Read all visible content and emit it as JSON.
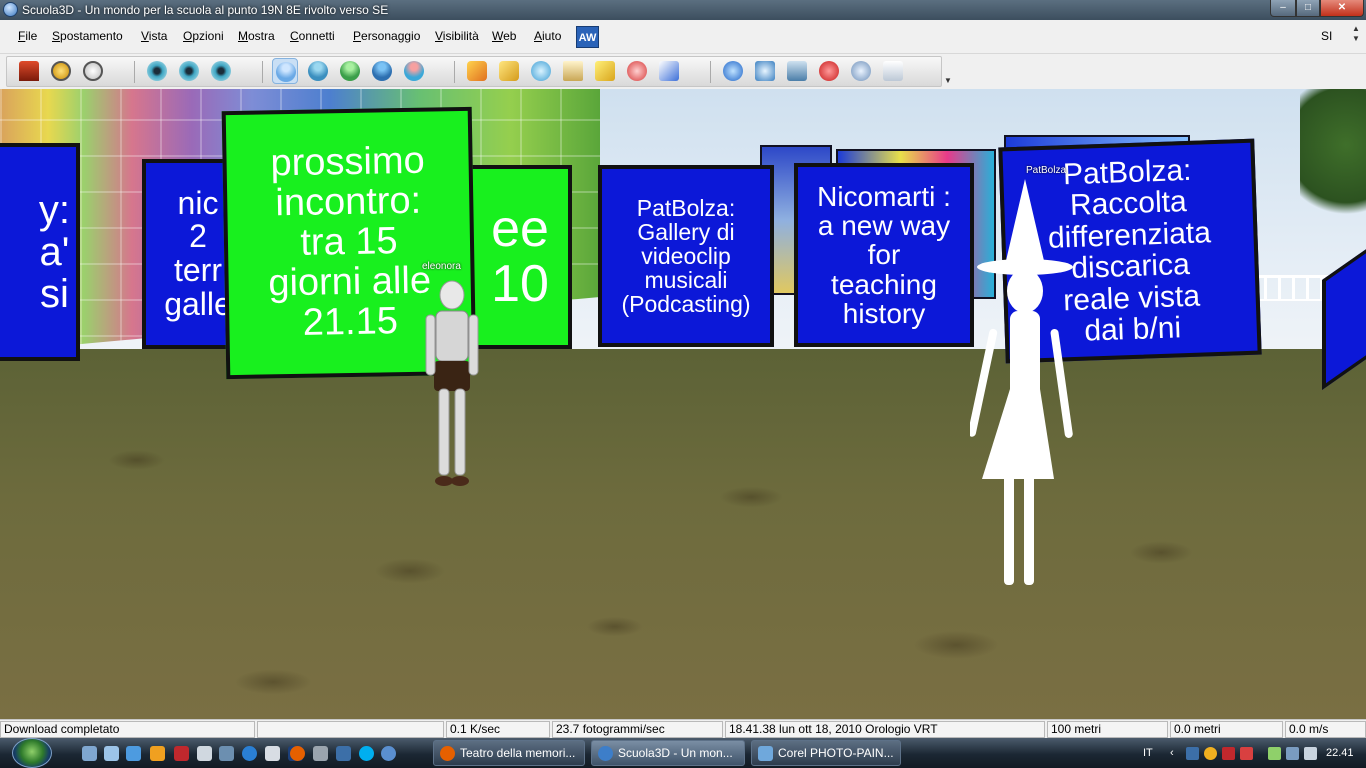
{
  "window": {
    "title": "Scuola3D  - Un mondo per la scuola al punto 19N 8E  rivolto verso SE",
    "min": "–",
    "max": "□",
    "close": "✕"
  },
  "menu": {
    "items": [
      "File",
      "Spostamento",
      "Vista",
      "Opzioni",
      "Mostra",
      "Connetti",
      "Personaggio",
      "Visibilità",
      "Web",
      "Aiuto"
    ],
    "aw_logo": "AW",
    "right_label": "SI"
  },
  "toolbar": {
    "icons": [
      "home-icon",
      "back-icon",
      "stop-icon",
      "eye-icon",
      "eye-left-icon",
      "eye-right-icon",
      "avatar-icon",
      "telegram-icon",
      "contacts-icon",
      "friends-icon",
      "chat-users-icon",
      "teleport-icon",
      "build-icon",
      "chat-bubble-icon",
      "notes-icon",
      "edit-icon",
      "help-icon",
      "lightning-icon",
      "browser-icon",
      "aw-icon",
      "camera-icon",
      "close-circle-icon",
      "settings-icon",
      "shirt-icon"
    ]
  },
  "scene": {
    "panels": [
      {
        "text": "y:\na'\nsi",
        "color": "blue"
      },
      {
        "text": "nic\n2\nterr\ngalle",
        "color": "blue"
      },
      {
        "text": "prossimo\nincontro:\ntra 15\ngiorni alle\n21.15",
        "color": "green"
      },
      {
        "text": "ee\n10",
        "color": "green"
      },
      {
        "text": "PatBolza:\nGallery di\nvideoclip\nmusicali\n(Podcasting)",
        "color": "blue"
      },
      {
        "text": "Nicomarti :\na new way\nfor\nteaching\nhistory",
        "color": "blue"
      },
      {
        "text": "PatBolza:\nRaccolta\ndifferenziata\ndiscarica\nreale vista\ndai b/ni",
        "color": "blue"
      }
    ],
    "avatars": [
      {
        "name": "eleonora"
      },
      {
        "name": "PatBolza"
      }
    ]
  },
  "status": {
    "message": "Download completato",
    "blank": "",
    "speed": "0.1 K/sec",
    "fps": "23.7 fotogrammi/sec",
    "clock": "18.41.38 lun ott 18, 2010 Orologio VRT",
    "visibility": "100 metri",
    "altitude": "0.0 metri",
    "velocity": "0.0 m/s"
  },
  "taskbar": {
    "buttons": [
      {
        "label": "Teatro della memori..."
      },
      {
        "label": "Scuola3D  - Un mon..."
      },
      {
        "label": "Corel PHOTO-PAIN..."
      }
    ],
    "language": "IT",
    "time": "22.41",
    "colors": {
      "firefox": "#e66000",
      "scuola": "#3d7ec9",
      "corel": "#6fa8dc"
    }
  }
}
